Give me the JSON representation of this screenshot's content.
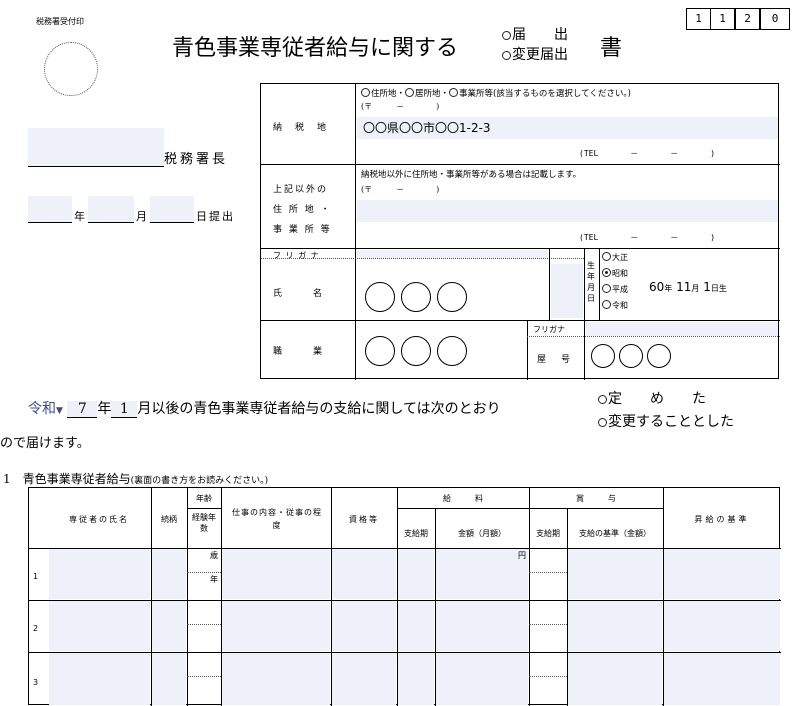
{
  "stamp": {
    "label": "税務署受付印"
  },
  "form_number": [
    "1",
    "1",
    "2",
    "0"
  ],
  "title": {
    "main": "青色事業専従者給与に関する",
    "opt1": "届　　出",
    "opt2": "変更届出",
    "suffix": "書"
  },
  "left": {
    "office_suffix": "税務署長",
    "year": "年",
    "month": "月",
    "day_submit": "日提出"
  },
  "info": {
    "taxplace_label": "納　税　地",
    "taxplace_choice": "住所地・",
    "taxplace_choice2": "居所地・",
    "taxplace_choice3": "事業所等(該当するものを選択してください。)",
    "postal": "(〒　　　－　　　　)",
    "address": "〇〇県〇〇市〇〇1-2-3",
    "tel": "(TEL　　　　－　　　　－　　　　)",
    "other_label1": "上記以外の",
    "other_label2": "住 所 地 ・",
    "other_label3": "事 業 所 等",
    "other_note": "納税地以外に住所地・事業所等がある場合は記載します。",
    "postal2": "(〒　　　－　　　　)",
    "tel2": "(TEL　　　　－　　　　－　　　　)",
    "furigana": "フ リ ガ ナ",
    "name_label": "氏　　　名",
    "birth_label": "生年月日",
    "era": [
      "大正",
      "昭和",
      "平成",
      "令和"
    ],
    "birth_year": "60",
    "birth_year_unit": "年",
    "birth_month": "11",
    "birth_month_unit": "月",
    "birth_day": "1",
    "birth_day_unit": "日生",
    "job_label": "職　　　業",
    "shop_furigana": "フリガナ",
    "shop_label": "屋　号"
  },
  "statement": {
    "era": "令和",
    "year": "7",
    "year_unit": "年",
    "month": "1",
    "text": "月以後の青色事業専従者給与の支給に関しては次のとおり",
    "choice1": "定　　め　　た",
    "choice2": "変更することとした",
    "tail": "ので届けます。"
  },
  "section1": {
    "title": "1　青色事業専従者給与",
    "note": "(裏面の書き方をお読みください。)"
  },
  "table": {
    "headers": {
      "name": "専従者の氏名",
      "relation": "続柄",
      "age": "年齢",
      "exp": "経験年数",
      "job": "仕事の内容・従事の程度",
      "qual": "資格等",
      "salary": "給　　　料",
      "salary_period": "支給期",
      "salary_amount": "金額（月額）",
      "bonus": "賞　　　与",
      "bonus_period": "支給期",
      "bonus_basis": "支給の基準（金額）",
      "raise": "昇給の基準"
    },
    "age_unit": "歳",
    "exp_unit": "年",
    "yen": "円",
    "rows": [
      "1",
      "2",
      "3"
    ]
  }
}
